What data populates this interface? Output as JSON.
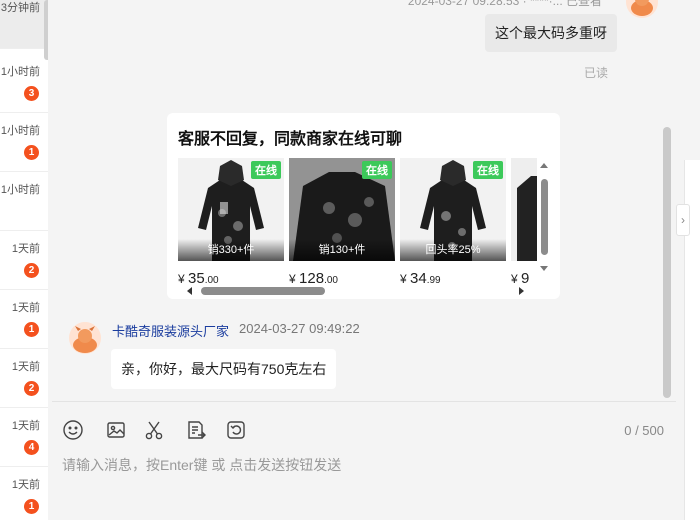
{
  "conversations": [
    {
      "time": "3分钟前",
      "badge": ""
    },
    {
      "time": "1小时前",
      "badge": "3"
    },
    {
      "time": "1小时前",
      "badge": "1"
    },
    {
      "time": "1小时前",
      "badge": ""
    },
    {
      "time": "1天前",
      "badge": "2"
    },
    {
      "time": "1天前",
      "badge": "1"
    },
    {
      "time": "1天前",
      "badge": "2"
    },
    {
      "time": "1天前",
      "badge": "4"
    },
    {
      "time": "1天前",
      "badge": "1"
    }
  ],
  "chat": {
    "top_meta": "2024-03-27 09:28:53 · ****·... 已查看",
    "sent_message": "这个最大码多重呀",
    "read_status": "已读",
    "card": {
      "title": "客服不回复，同款商家在线可聊",
      "products": [
        {
          "online": "在线",
          "stat": "销330+件",
          "price_symbol": "¥",
          "price_int": "35",
          "price_dec": ".00"
        },
        {
          "online": "在线",
          "stat": "销130+件",
          "price_symbol": "¥",
          "price_int": "128",
          "price_dec": ".00"
        },
        {
          "online": "在线",
          "stat": "回头率25%",
          "price_symbol": "¥",
          "price_int": "34",
          "price_dec": ".99"
        },
        {
          "online": "",
          "stat": "",
          "price_symbol": "¥",
          "price_int": "9",
          "price_dec": ""
        }
      ]
    },
    "sender_name": "卡酷奇服装源头厂家",
    "sender_time": "2024-03-27 09:49:22",
    "received_message": "亲，你好，最大尺码有750克左右"
  },
  "composer": {
    "char_count": "0 / 500",
    "placeholder": "请输入消息，按Enter键 或 点击发送按钮发送",
    "tools": [
      "emoji-icon",
      "image-icon",
      "scissors-icon",
      "document-send-icon",
      "history-icon"
    ]
  },
  "colors": {
    "badge": "#f4511e",
    "online": "#3cc95a",
    "sender_name": "#1a3c9e"
  }
}
